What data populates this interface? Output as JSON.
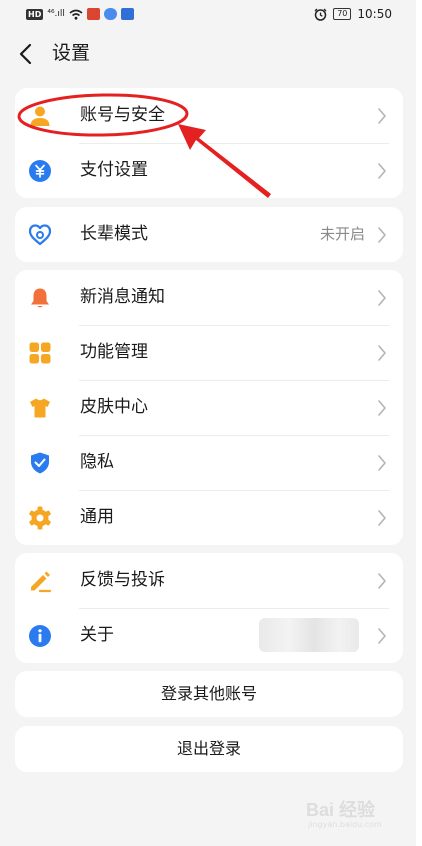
{
  "status_bar": {
    "hd_label": "HD",
    "signal_label": "⁴⁶.ıll",
    "battery_label": "70",
    "time": "10:50"
  },
  "header": {
    "title": "设置",
    "back_icon": "chevron-left-icon"
  },
  "groups": {
    "account": {
      "items": [
        {
          "label": "账号与安全",
          "icon": "user-icon"
        },
        {
          "label": "支付设置",
          "icon": "yuan-icon"
        }
      ]
    },
    "elder": {
      "items": [
        {
          "label": "长辈模式",
          "value": "未开启",
          "icon": "heart-icon"
        }
      ]
    },
    "main": {
      "items": [
        {
          "label": "新消息通知",
          "icon": "bell-icon"
        },
        {
          "label": "功能管理",
          "icon": "grid-icon"
        },
        {
          "label": "皮肤中心",
          "icon": "shirt-icon"
        },
        {
          "label": "隐私",
          "icon": "shield-icon"
        },
        {
          "label": "通用",
          "icon": "gear-icon"
        }
      ]
    },
    "support": {
      "items": [
        {
          "label": "反馈与投诉",
          "icon": "edit-icon"
        },
        {
          "label": "关于",
          "icon": "info-icon"
        }
      ]
    }
  },
  "buttons": {
    "login_other": "登录其他账号",
    "logout": "退出登录"
  },
  "watermark": {
    "text": "Bai 经验",
    "sub": "jingyan.baidu.com"
  },
  "colors": {
    "background": "#f4f4f4",
    "card": "#ffffff",
    "orange": "#f5a623",
    "blue": "#2a7bf0",
    "red_orange": "#f2703a",
    "annotation_red": "#e52020"
  }
}
